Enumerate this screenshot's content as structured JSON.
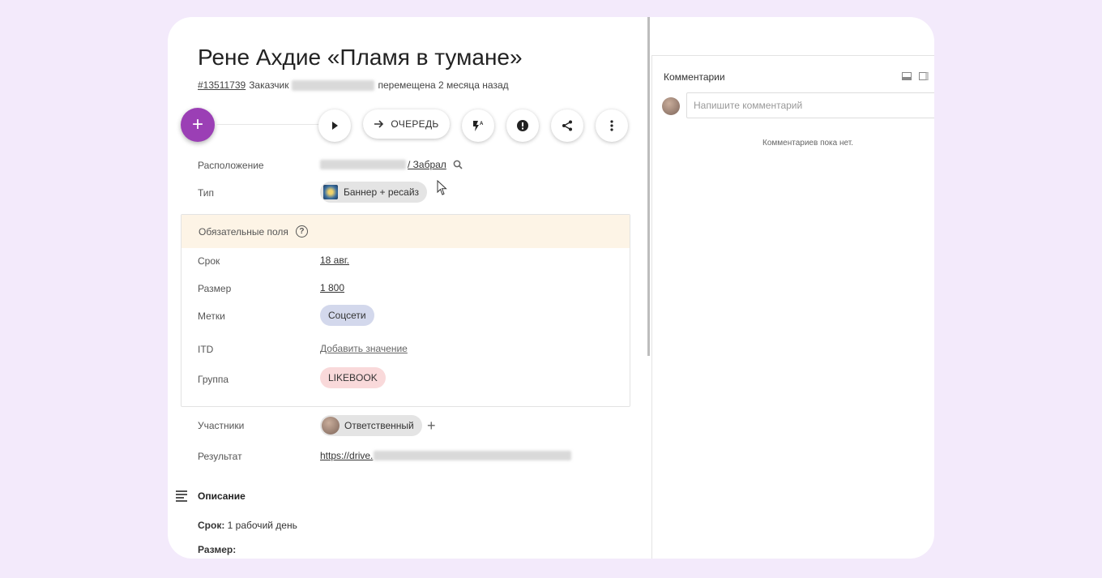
{
  "task": {
    "title": "Рене Ахдие «Пламя в тумане»",
    "id": "#13511739",
    "customer_label": "Заказчик",
    "moved_text": "перемещена 2 месяца назад"
  },
  "toolbar": {
    "add_icon": "plus-icon",
    "queue_label": "ОЧЕРЕДЬ",
    "icons": [
      "play-icon",
      "arrow-right-icon",
      "flash-auto-icon",
      "alert-icon",
      "share-icon",
      "more-vert-icon"
    ]
  },
  "fields": {
    "location_label": "Расположение",
    "location_value": "/ Забрал",
    "type_label": "Тип",
    "type_value": "Баннер + ресайз"
  },
  "required": {
    "header": "Обязательные поля",
    "deadline_label": "Срок",
    "deadline_value": "18 авг.",
    "size_label": "Размер",
    "size_value": "1 800",
    "tags_label": "Метки",
    "tags_value": "Соцсети",
    "itd_label": "ITD",
    "itd_value": "Добавить значение",
    "group_label": "Группа",
    "group_value": "LIKEBOOK"
  },
  "people": {
    "participants_label": "Участники",
    "participant_role": "Ответственный",
    "result_label": "Результат",
    "result_link": "https://drive."
  },
  "description": {
    "title": "Описание",
    "line1_bold": "Срок:",
    "line1_rest": "1 рабочий день",
    "line2_bold": "Размер:"
  },
  "comments": {
    "title": "Комментарии",
    "placeholder": "Напишите комментарий",
    "empty": "Комментариев пока нет."
  },
  "colors": {
    "accent": "#9b3fb5",
    "required_header_bg": "#fdf4e6",
    "tag_social": "#d3d8ec",
    "tag_group": "#f9d9da",
    "chip_gray": "#e4e4e4"
  }
}
